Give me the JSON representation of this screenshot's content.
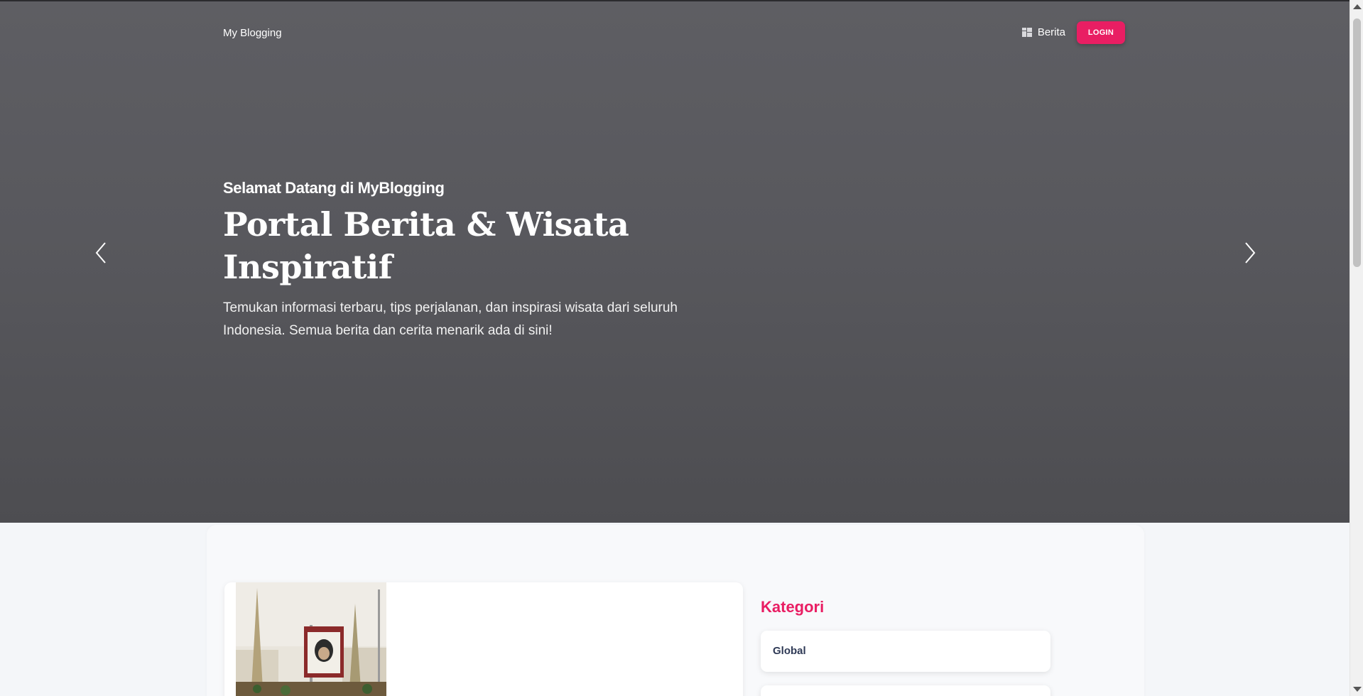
{
  "navbar": {
    "brand": "My Blogging",
    "berita_label": "Berita",
    "login_label": "LOGIN"
  },
  "hero": {
    "kicker": "Selamat Datang di MyBlogging",
    "title_line1": "Portal Berita & Wisata",
    "title_line2": "Inspiratif",
    "description": "Temukan informasi terbaru, tips perjalanan, dan inspirasi wisata dari seluruh Indonesia. Semua berita dan cerita menarik ada di sini!",
    "prev_icon": "chevron-left-icon",
    "next_icon": "chevron-right-icon"
  },
  "sidebar": {
    "title": "Kategori",
    "categories": [
      "Global"
    ]
  },
  "colors": {
    "accent": "#e91e63",
    "hero_bg": "#58585d",
    "page_bg": "#f4f6f9",
    "category_text": "#2f3a56"
  }
}
